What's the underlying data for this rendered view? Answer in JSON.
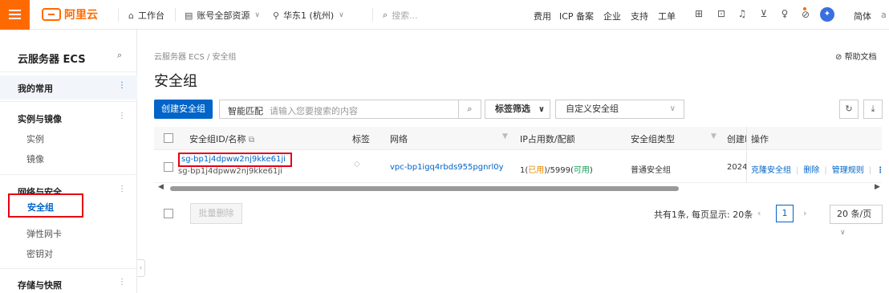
{
  "header": {
    "logo_text": "阿里云",
    "nav": [
      {
        "label": "工作台"
      },
      {
        "label": "账号全部资源"
      },
      {
        "label": "华东1 (杭州)"
      }
    ],
    "search_placeholder": "搜索...",
    "right_links": [
      "费用",
      "ICP 备案",
      "企业",
      "支持",
      "工单"
    ],
    "lang": "简体",
    "avatar_letter": "a"
  },
  "sidebar": {
    "title": "云服务器 ECS",
    "favorites": "我的常用",
    "groups": [
      {
        "label": "实例与镜像",
        "items": [
          "实例",
          "镜像"
        ]
      },
      {
        "label": "网络与安全",
        "items": [
          "安全组",
          "弹性网卡",
          "密钥对"
        ]
      },
      {
        "label": "存储与快照",
        "items": []
      }
    ]
  },
  "breadcrumb": "云服务器 ECS  /  安全组",
  "help_text": "帮助文档",
  "page_title": "安全组",
  "toolbar": {
    "create_label": "创建安全组",
    "search_type": "智能匹配",
    "search_placeholder": "请输入您要搜索的内容",
    "tag_filter": "标签筛选",
    "custom_select": "自定义安全组"
  },
  "table": {
    "headers": {
      "id_name": "安全组ID/名称",
      "tags": "标签",
      "network": "网络",
      "ip_usage": "IP占用数/配额",
      "type": "安全组类型",
      "created": "创建时",
      "actions": "操作"
    },
    "rows": [
      {
        "id": "sg-bp1j4dpww2nj9kke61ji",
        "name": "sg-bp1j4dpww2nj9kke61ji",
        "network": "vpc-bp1igq4rbds955pgnrl0y",
        "ip_used": "1",
        "ip_used_label": "已用",
        "ip_quota": "5999",
        "ip_available_label": "可用",
        "type": "普通安全组",
        "created": "2024",
        "actions": [
          "克隆安全组",
          "删除",
          "管理规则"
        ]
      }
    ]
  },
  "footer": {
    "bulk_delete": "批量删除",
    "summary": "共有1条, 每页显示: 20条",
    "current_page": "1",
    "page_size": "20 条/页"
  }
}
